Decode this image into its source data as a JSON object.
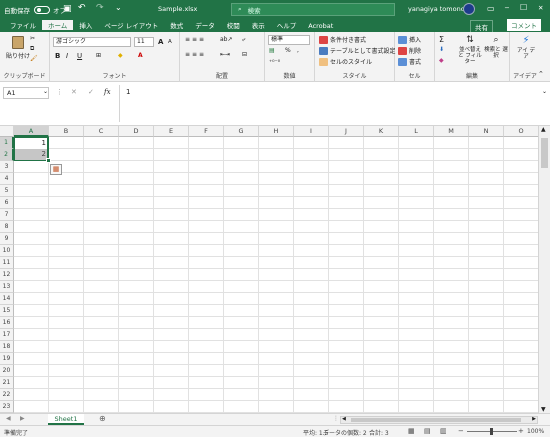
{
  "titlebar": {
    "autosave_label": "自動保存",
    "autosave_state": "オフ",
    "filename": "Sample.xlsx",
    "search_placeholder": "検索",
    "user_name": "yanagiya tomonori",
    "min_glyph": "─",
    "restore_glyph": "☐",
    "close_glyph": "✕"
  },
  "tabs": [
    "ファイル",
    "ホーム",
    "挿入",
    "ページ レイアウト",
    "数式",
    "データ",
    "校閲",
    "表示",
    "ヘルプ",
    "Acrobat"
  ],
  "share_label": "共有",
  "comment_label": "コメント",
  "ribbon": {
    "clipboard": {
      "label": "クリップボード",
      "paste": "貼り付け"
    },
    "font": {
      "label": "フォント",
      "name": "游ゴシック",
      "size": "11",
      "bold": "B",
      "italic": "I",
      "underline": "U",
      "grow": "A",
      "shrink": "A"
    },
    "alignment": {
      "label": "配置"
    },
    "number": {
      "label": "数値",
      "format": "標準",
      "percent": "%",
      "comma": ","
    },
    "styles": {
      "label": "スタイル",
      "cond": "条件付き書式",
      "table": "テーブルとして書式設定",
      "cell": "セルのスタイル"
    },
    "cells": {
      "label": "セル",
      "insert": "挿入",
      "delete": "削除",
      "format": "書式"
    },
    "editing": {
      "label": "編集",
      "sort": "並べ替えと フィルター",
      "find": "検索と 選択"
    },
    "ideas": {
      "label": "アイデア",
      "btn": "アイ デア"
    }
  },
  "formula": {
    "cell_ref": "A1",
    "value": "1",
    "fx": "fx"
  },
  "grid": {
    "columns": [
      "A",
      "B",
      "C",
      "D",
      "E",
      "F",
      "G",
      "H",
      "I",
      "J",
      "K",
      "L",
      "M",
      "N",
      "O"
    ],
    "rows": [
      "1",
      "2",
      "3",
      "4",
      "5",
      "6",
      "7",
      "8",
      "9",
      "10",
      "11",
      "12",
      "13",
      "14",
      "15",
      "16",
      "17",
      "18",
      "19",
      "20",
      "21",
      "22",
      "23"
    ],
    "cells": {
      "A1": "1",
      "A2": "2"
    }
  },
  "sheets": [
    "Sheet1"
  ],
  "status": {
    "ready": "準備完了",
    "average": "平均: 1.5",
    "count": "データの個数: 2",
    "sum": "合計: 3",
    "zoom": "100%"
  },
  "colors": {
    "accent": "#217346",
    "select": "#c6c6c6"
  }
}
